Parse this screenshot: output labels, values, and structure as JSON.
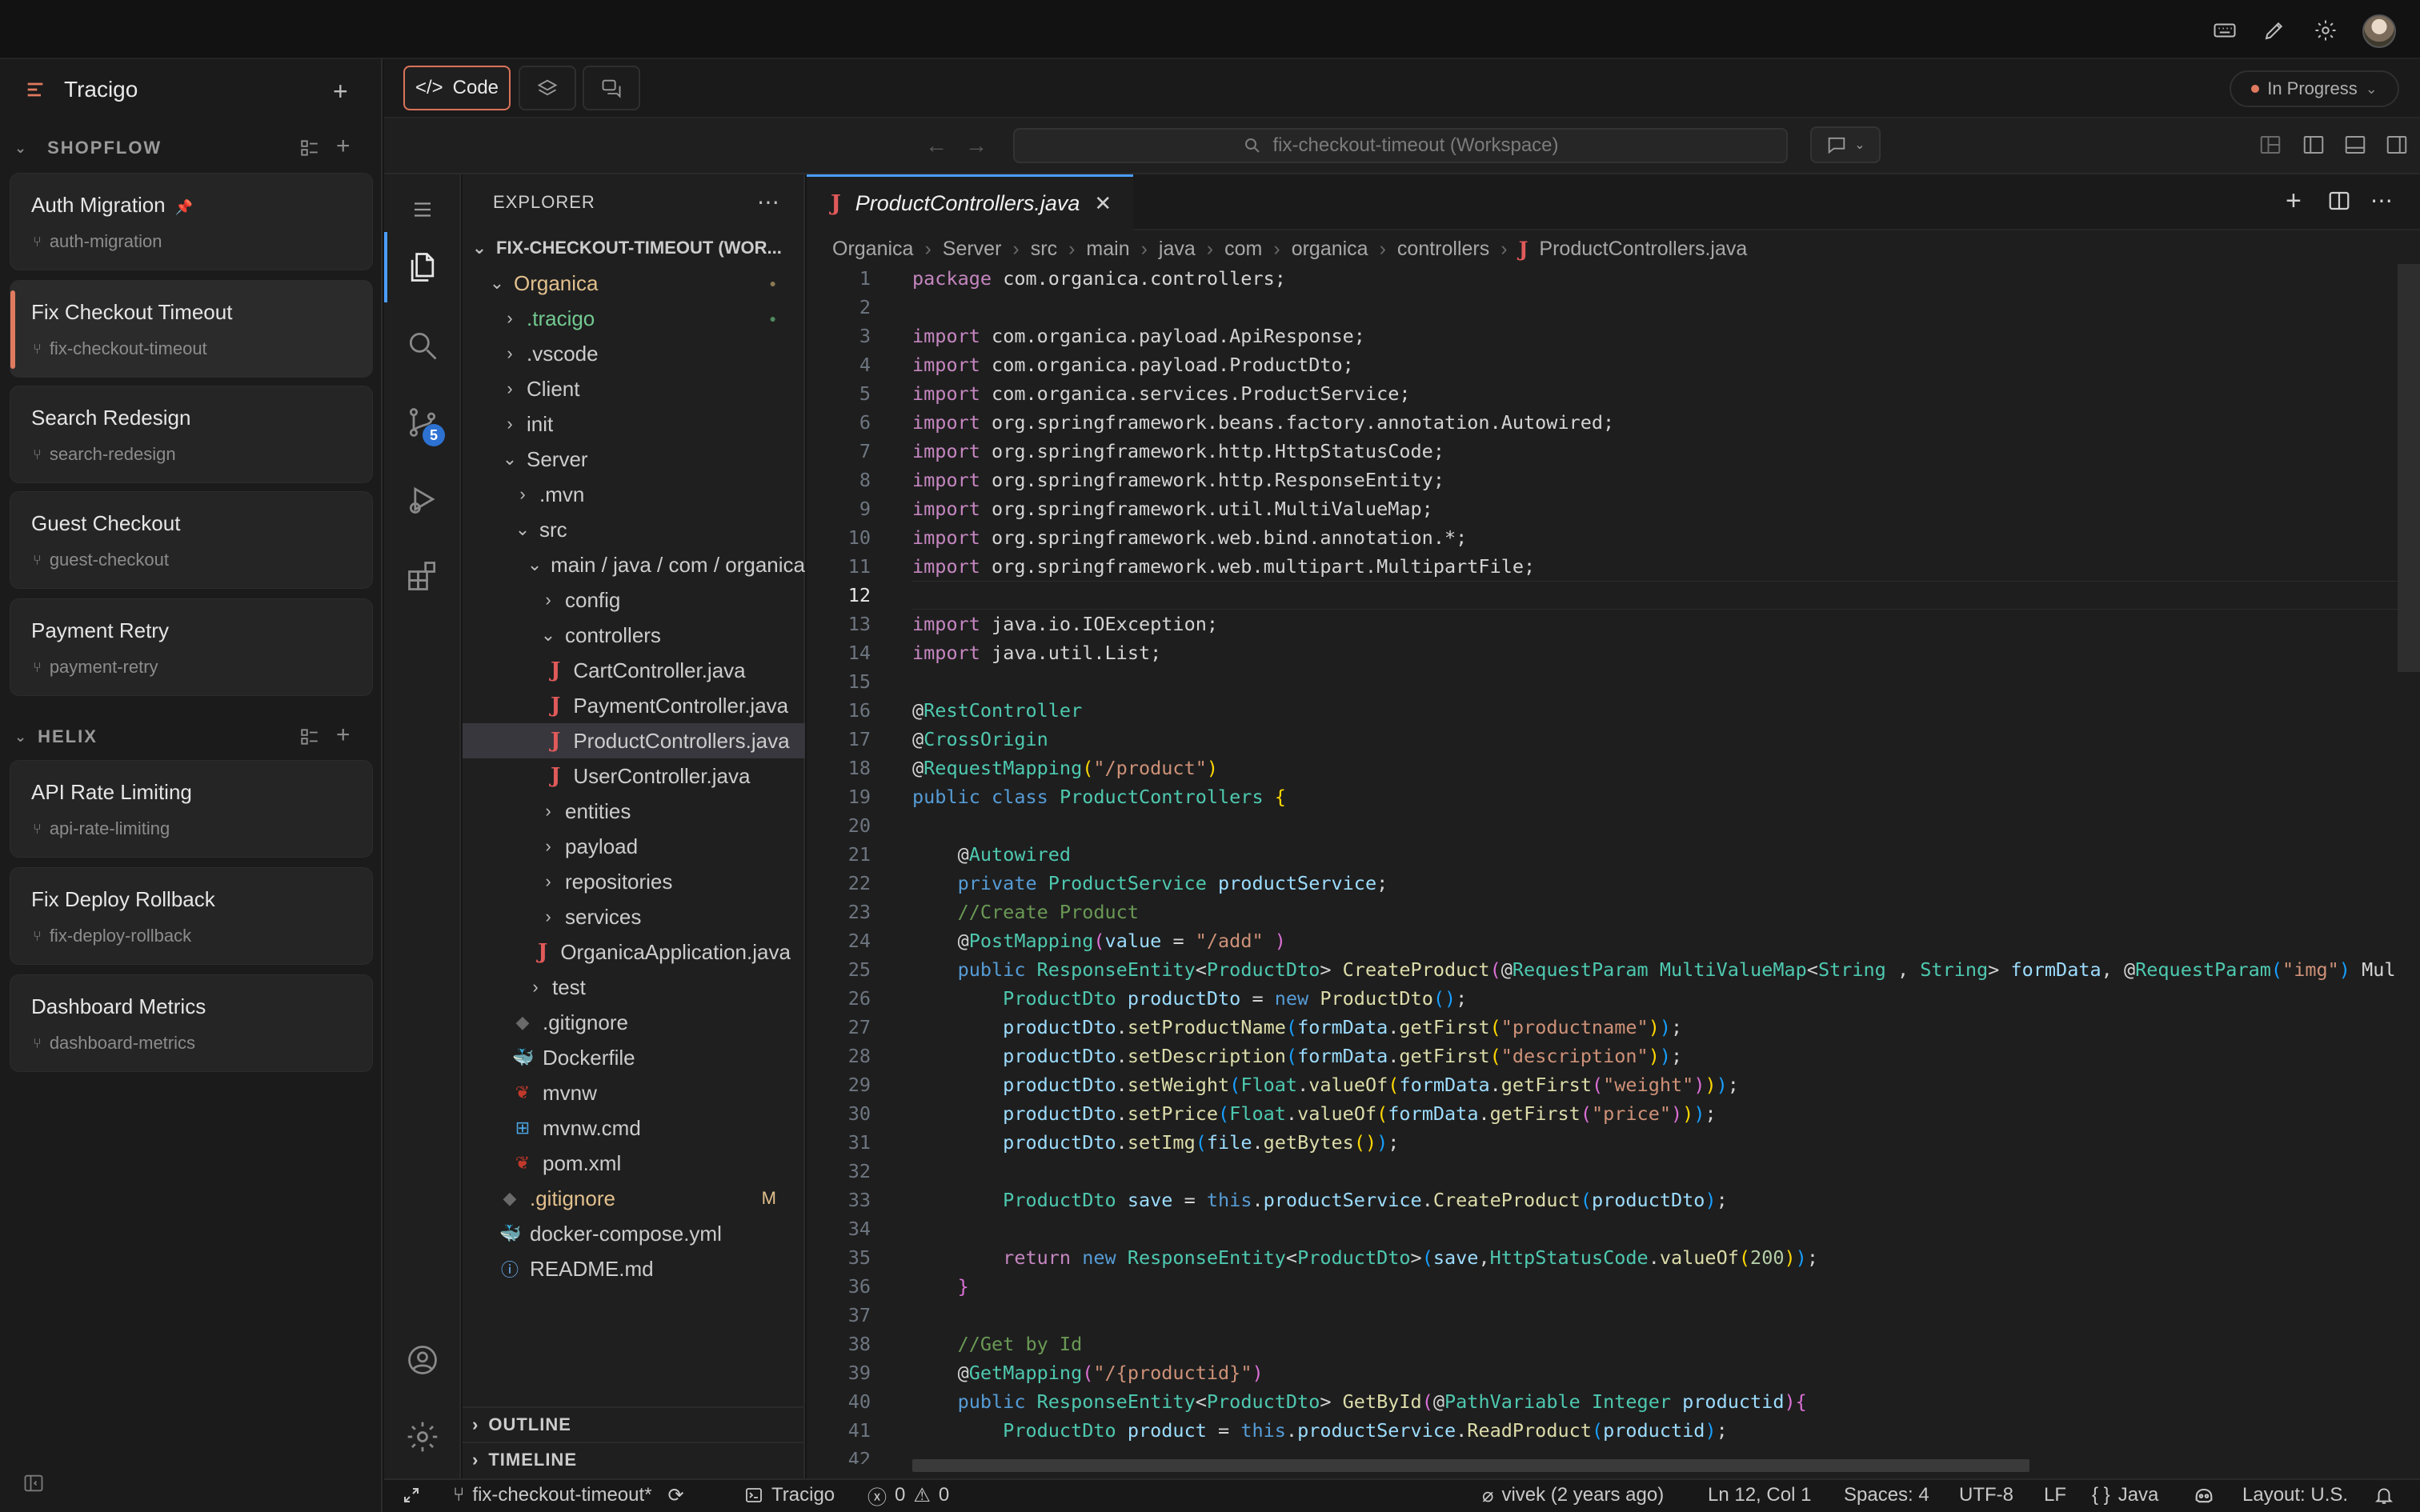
{
  "app": {
    "title": "Tracigo"
  },
  "sidebar": {
    "sections": [
      {
        "name": "SHOPFLOW",
        "tasks": [
          {
            "title": "Auth Migration",
            "branch": "auth-migration",
            "pinned": true
          },
          {
            "title": "Fix Checkout Timeout",
            "branch": "fix-checkout-timeout",
            "active": true
          },
          {
            "title": "Search Redesign",
            "branch": "search-redesign"
          },
          {
            "title": "Guest Checkout",
            "branch": "guest-checkout"
          },
          {
            "title": "Payment Retry",
            "branch": "payment-retry"
          }
        ]
      },
      {
        "name": "HELIX",
        "tasks": [
          {
            "title": "API Rate Limiting",
            "branch": "api-rate-limiting"
          },
          {
            "title": "Fix Deploy Rollback",
            "branch": "fix-deploy-rollback"
          },
          {
            "title": "Dashboard Metrics",
            "branch": "dashboard-metrics"
          }
        ]
      }
    ]
  },
  "toolbar": {
    "code_label": "Code",
    "status": "In Progress",
    "status_color": "#e07a5f"
  },
  "vscode": {
    "command_center": "fix-checkout-timeout (Workspace)",
    "scm_badge": "5",
    "explorer": {
      "title": "EXPLORER",
      "root": "FIX-CHECKOUT-TIMEOUT (WOR...",
      "items": [
        {
          "label": "Organica",
          "depth": 1,
          "chev": "v",
          "color": "#e2c08d",
          "mark": "dot",
          "mark_color": "#8c7a55"
        },
        {
          "label": ".tracigo",
          "depth": 2,
          "chev": ">",
          "color": "#73c991",
          "mark": "dot",
          "mark_color": "#4f8a5f"
        },
        {
          "label": ".vscode",
          "depth": 2,
          "chev": ">"
        },
        {
          "label": "Client",
          "depth": 2,
          "chev": ">"
        },
        {
          "label": "init",
          "depth": 2,
          "chev": ">"
        },
        {
          "label": "Server",
          "depth": 2,
          "chev": "v"
        },
        {
          "label": ".mvn",
          "depth": 3,
          "chev": ">"
        },
        {
          "label": "src",
          "depth": 3,
          "chev": "v"
        },
        {
          "label": "main / java / com / organica",
          "depth": 4,
          "chev": "v"
        },
        {
          "label": "config",
          "depth": 5,
          "chev": ">"
        },
        {
          "label": "controllers",
          "depth": 5,
          "chev": "v"
        },
        {
          "label": "CartController.java",
          "depth": 6,
          "icon": "java"
        },
        {
          "label": "PaymentController.java",
          "depth": 6,
          "icon": "java"
        },
        {
          "label": "ProductControllers.java",
          "depth": 6,
          "icon": "java",
          "selected": true
        },
        {
          "label": "UserController.java",
          "depth": 6,
          "icon": "java"
        },
        {
          "label": "entities",
          "depth": 5,
          "chev": ">"
        },
        {
          "label": "payload",
          "depth": 5,
          "chev": ">"
        },
        {
          "label": "repositories",
          "depth": 5,
          "chev": ">"
        },
        {
          "label": "services",
          "depth": 5,
          "chev": ">"
        },
        {
          "label": "OrganicaApplication.java",
          "depth": 5,
          "icon": "java"
        },
        {
          "label": "test",
          "depth": 4,
          "chev": ">"
        },
        {
          "label": ".gitignore",
          "depth": 3,
          "icon": "git"
        },
        {
          "label": "Dockerfile",
          "depth": 3,
          "icon": "docker"
        },
        {
          "label": "mvnw",
          "depth": 3,
          "icon": "maven"
        },
        {
          "label": "mvnw.cmd",
          "depth": 3,
          "icon": "windows"
        },
        {
          "label": "pom.xml",
          "depth": 3,
          "icon": "maven"
        },
        {
          "label": ".gitignore",
          "depth": 2,
          "icon": "git",
          "color": "#e2c08d",
          "mark": "M",
          "mark_color": "#e2c08d"
        },
        {
          "label": "docker-compose.yml",
          "depth": 2,
          "icon": "compose"
        },
        {
          "label": "README.md",
          "depth": 2,
          "icon": "info"
        }
      ],
      "outline": "OUTLINE",
      "timeline": "TIMELINE"
    },
    "tab": {
      "filename": "ProductControllers.java"
    },
    "breadcrumb": [
      "Organica",
      "Server",
      "src",
      "main",
      "java",
      "com",
      "organica",
      "controllers",
      "ProductControllers.java"
    ],
    "code_lines": [
      [
        [
          "kw",
          "package "
        ],
        [
          "",
          "com.organica.controllers;"
        ]
      ],
      [],
      [
        [
          "kw",
          "import "
        ],
        [
          "",
          "com.organica.payload.ApiResponse;"
        ]
      ],
      [
        [
          "kw",
          "import "
        ],
        [
          "",
          "com.organica.payload.ProductDto;"
        ]
      ],
      [
        [
          "kw",
          "import "
        ],
        [
          "",
          "com.organica.services.ProductService;"
        ]
      ],
      [
        [
          "kw",
          "import "
        ],
        [
          "",
          "org.springframework.beans.factory.annotation.Autowired;"
        ]
      ],
      [
        [
          "kw",
          "import "
        ],
        [
          "",
          "org.springframework.http.HttpStatusCode;"
        ]
      ],
      [
        [
          "kw",
          "import "
        ],
        [
          "",
          "org.springframework.http.ResponseEntity;"
        ]
      ],
      [
        [
          "kw",
          "import "
        ],
        [
          "",
          "org.springframework.util.MultiValueMap;"
        ]
      ],
      [
        [
          "kw",
          "import "
        ],
        [
          "",
          "org.springframework.web.bind.annotation.*;"
        ]
      ],
      [
        [
          "kw",
          "import "
        ],
        [
          "",
          "org.springframework.web.multipart.MultipartFile;"
        ]
      ],
      [],
      [
        [
          "kw",
          "import "
        ],
        [
          "",
          "java.io.IOException;"
        ]
      ],
      [
        [
          "kw",
          "import "
        ],
        [
          "",
          "java.util.List;"
        ]
      ],
      [],
      [
        [
          "",
          "@"
        ],
        [
          "an",
          "RestController"
        ]
      ],
      [
        [
          "",
          "@"
        ],
        [
          "an",
          "CrossOrigin"
        ]
      ],
      [
        [
          "",
          "@"
        ],
        [
          "an",
          "RequestMapping"
        ],
        [
          "br1",
          "("
        ],
        [
          "st",
          "\"/product\""
        ],
        [
          "br1",
          ")"
        ]
      ],
      [
        [
          "bl",
          "public class "
        ],
        [
          "ty",
          "ProductControllers "
        ],
        [
          "br1",
          "{"
        ]
      ],
      [],
      [
        [
          "",
          "    @"
        ],
        [
          "an",
          "Autowired"
        ]
      ],
      [
        [
          "bl",
          "    private "
        ],
        [
          "ty",
          "ProductService "
        ],
        [
          "va",
          "productService"
        ],
        [
          "",
          ";"
        ]
      ],
      [
        [
          "cm",
          "    //Create Product"
        ]
      ],
      [
        [
          "",
          "    @"
        ],
        [
          "an",
          "PostMapping"
        ],
        [
          "br2",
          "("
        ],
        [
          "va",
          "value "
        ],
        [
          "",
          "= "
        ],
        [
          "st",
          "\"/add\" "
        ],
        [
          "br2",
          ")"
        ]
      ],
      [
        [
          "bl",
          "    public "
        ],
        [
          "ty",
          "ResponseEntity"
        ],
        [
          "",
          "<"
        ],
        [
          "ty",
          "ProductDto"
        ],
        [
          "",
          "> "
        ],
        [
          "fn",
          "CreateProduct"
        ],
        [
          "br2",
          "("
        ],
        [
          "",
          "@"
        ],
        [
          "an",
          "RequestParam "
        ],
        [
          "ty",
          "MultiValueMap"
        ],
        [
          "",
          "<"
        ],
        [
          "ty",
          "String"
        ],
        [
          "",
          " , "
        ],
        [
          "ty",
          "String"
        ],
        [
          "",
          "> "
        ],
        [
          "va",
          "formData"
        ],
        [
          "",
          ", @"
        ],
        [
          "an",
          "RequestParam"
        ],
        [
          "br3",
          "("
        ],
        [
          "st",
          "\"img\""
        ],
        [
          "br3",
          ")"
        ],
        [
          "",
          " Mul"
        ]
      ],
      [
        [
          "ty",
          "        ProductDto "
        ],
        [
          "va",
          "productDto "
        ],
        [
          "",
          "= "
        ],
        [
          "bl",
          "new "
        ],
        [
          "fn",
          "ProductDto"
        ],
        [
          "br3",
          "()"
        ],
        [
          "",
          ";"
        ]
      ],
      [
        [
          "va",
          "        productDto"
        ],
        [
          "",
          "."
        ],
        [
          "fn",
          "setProductName"
        ],
        [
          "br3",
          "("
        ],
        [
          "va",
          "formData"
        ],
        [
          "",
          "."
        ],
        [
          "fn",
          "getFirst"
        ],
        [
          "br1",
          "("
        ],
        [
          "st",
          "\"productname\""
        ],
        [
          "br1",
          ")"
        ],
        [
          "br3",
          ")"
        ],
        [
          "",
          ";"
        ]
      ],
      [
        [
          "va",
          "        productDto"
        ],
        [
          "",
          "."
        ],
        [
          "fn",
          "setDescription"
        ],
        [
          "br3",
          "("
        ],
        [
          "va",
          "formData"
        ],
        [
          "",
          "."
        ],
        [
          "fn",
          "getFirst"
        ],
        [
          "br1",
          "("
        ],
        [
          "st",
          "\"description\""
        ],
        [
          "br1",
          ")"
        ],
        [
          "br3",
          ")"
        ],
        [
          "",
          ";"
        ]
      ],
      [
        [
          "va",
          "        productDto"
        ],
        [
          "",
          "."
        ],
        [
          "fn",
          "setWeight"
        ],
        [
          "br3",
          "("
        ],
        [
          "ty",
          "Float"
        ],
        [
          "",
          "."
        ],
        [
          "fn",
          "valueOf"
        ],
        [
          "br1",
          "("
        ],
        [
          "va",
          "formData"
        ],
        [
          "",
          "."
        ],
        [
          "fn",
          "getFirst"
        ],
        [
          "br2",
          "("
        ],
        [
          "st",
          "\"weight\""
        ],
        [
          "br2",
          ")"
        ],
        [
          "br1",
          ")"
        ],
        [
          "br3",
          ")"
        ],
        [
          "",
          ";"
        ]
      ],
      [
        [
          "va",
          "        productDto"
        ],
        [
          "",
          "."
        ],
        [
          "fn",
          "setPrice"
        ],
        [
          "br3",
          "("
        ],
        [
          "ty",
          "Float"
        ],
        [
          "",
          "."
        ],
        [
          "fn",
          "valueOf"
        ],
        [
          "br1",
          "("
        ],
        [
          "va",
          "formData"
        ],
        [
          "",
          "."
        ],
        [
          "fn",
          "getFirst"
        ],
        [
          "br2",
          "("
        ],
        [
          "st",
          "\"price\""
        ],
        [
          "br2",
          ")"
        ],
        [
          "br1",
          ")"
        ],
        [
          "br3",
          ")"
        ],
        [
          "",
          ";"
        ]
      ],
      [
        [
          "va",
          "        productDto"
        ],
        [
          "",
          "."
        ],
        [
          "fn",
          "setImg"
        ],
        [
          "br3",
          "("
        ],
        [
          "va",
          "file"
        ],
        [
          "",
          "."
        ],
        [
          "fn",
          "getBytes"
        ],
        [
          "br1",
          "()"
        ],
        [
          "br3",
          ")"
        ],
        [
          "",
          ";"
        ]
      ],
      [],
      [
        [
          "ty",
          "        ProductDto "
        ],
        [
          "va",
          "save "
        ],
        [
          "",
          "= "
        ],
        [
          "bl",
          "this"
        ],
        [
          "",
          "."
        ],
        [
          "va",
          "productService"
        ],
        [
          "",
          "."
        ],
        [
          "fn",
          "CreateProduct"
        ],
        [
          "br3",
          "("
        ],
        [
          "va",
          "productDto"
        ],
        [
          "br3",
          ")"
        ],
        [
          "",
          ";"
        ]
      ],
      [],
      [
        [
          "kw",
          "        return "
        ],
        [
          "bl",
          "new "
        ],
        [
          "ty",
          "ResponseEntity"
        ],
        [
          "",
          "<"
        ],
        [
          "ty",
          "ProductDto"
        ],
        [
          "",
          ">"
        ],
        [
          "br3",
          "("
        ],
        [
          "va",
          "save"
        ],
        [
          "",
          ","
        ],
        [
          "ty",
          "HttpStatusCode"
        ],
        [
          "",
          "."
        ],
        [
          "fn",
          "valueOf"
        ],
        [
          "br1",
          "("
        ],
        [
          "nu",
          "200"
        ],
        [
          "br1",
          ")"
        ],
        [
          "br3",
          ")"
        ],
        [
          "",
          ";"
        ]
      ],
      [
        [
          "br2",
          "    }"
        ]
      ],
      [],
      [
        [
          "cm",
          "    //Get by Id"
        ]
      ],
      [
        [
          "",
          "    @"
        ],
        [
          "an",
          "GetMapping"
        ],
        [
          "br2",
          "("
        ],
        [
          "st",
          "\"/{productid}\""
        ],
        [
          "br2",
          ")"
        ]
      ],
      [
        [
          "bl",
          "    public "
        ],
        [
          "ty",
          "ResponseEntity"
        ],
        [
          "",
          "<"
        ],
        [
          "ty",
          "ProductDto"
        ],
        [
          "",
          "> "
        ],
        [
          "fn",
          "GetById"
        ],
        [
          "br2",
          "("
        ],
        [
          "",
          "@"
        ],
        [
          "an",
          "PathVariable "
        ],
        [
          "ty",
          "Integer "
        ],
        [
          "va",
          "productid"
        ],
        [
          "br2",
          ")"
        ],
        [
          "br2",
          "{"
        ]
      ],
      [
        [
          "ty",
          "        ProductDto "
        ],
        [
          "va",
          "product "
        ],
        [
          "",
          "= "
        ],
        [
          "bl",
          "this"
        ],
        [
          "",
          "."
        ],
        [
          "va",
          "productService"
        ],
        [
          "",
          "."
        ],
        [
          "fn",
          "ReadProduct"
        ],
        [
          "br3",
          "("
        ],
        [
          "va",
          "productid"
        ],
        [
          "br3",
          ")"
        ],
        [
          "",
          ";"
        ]
      ],
      []
    ],
    "current_line": 12,
    "status": {
      "branch": "fix-checkout-timeout*",
      "tracigo": "Tracigo",
      "errors": "0",
      "warnings": "0",
      "blame": "vivek (2 years ago)",
      "cursor": "Ln 12, Col 1",
      "spaces": "Spaces: 4",
      "encoding": "UTF-8",
      "eol": "LF",
      "language": "Java",
      "layout": "Layout: U.S."
    }
  }
}
